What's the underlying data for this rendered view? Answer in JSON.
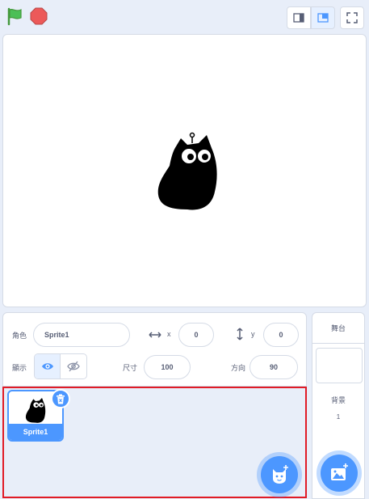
{
  "toolbar": {
    "green_flag_icon": "green-flag-icon",
    "stop_icon": "stop-icon",
    "small_stage_icon": "small-stage-icon",
    "large_stage_icon": "large-stage-icon",
    "fullscreen_icon": "fullscreen-icon"
  },
  "sprite_info": {
    "sprite_label": "角色",
    "sprite_name": "Sprite1",
    "x_label": "x",
    "x_value": "0",
    "y_label": "y",
    "y_value": "0",
    "show_label": "顯示",
    "size_label": "尺寸",
    "size_value": "100",
    "direction_label": "方向",
    "direction_value": "90"
  },
  "sprites": [
    {
      "name": "Sprite1",
      "selected": true
    }
  ],
  "stage_panel": {
    "title": "舞台",
    "backdrop_label": "背景",
    "backdrop_count": "1"
  },
  "colors": {
    "accent": "#4c97ff",
    "flag": "#4cbf56",
    "stop": "#ec5959",
    "highlight_border": "#e11b26"
  }
}
